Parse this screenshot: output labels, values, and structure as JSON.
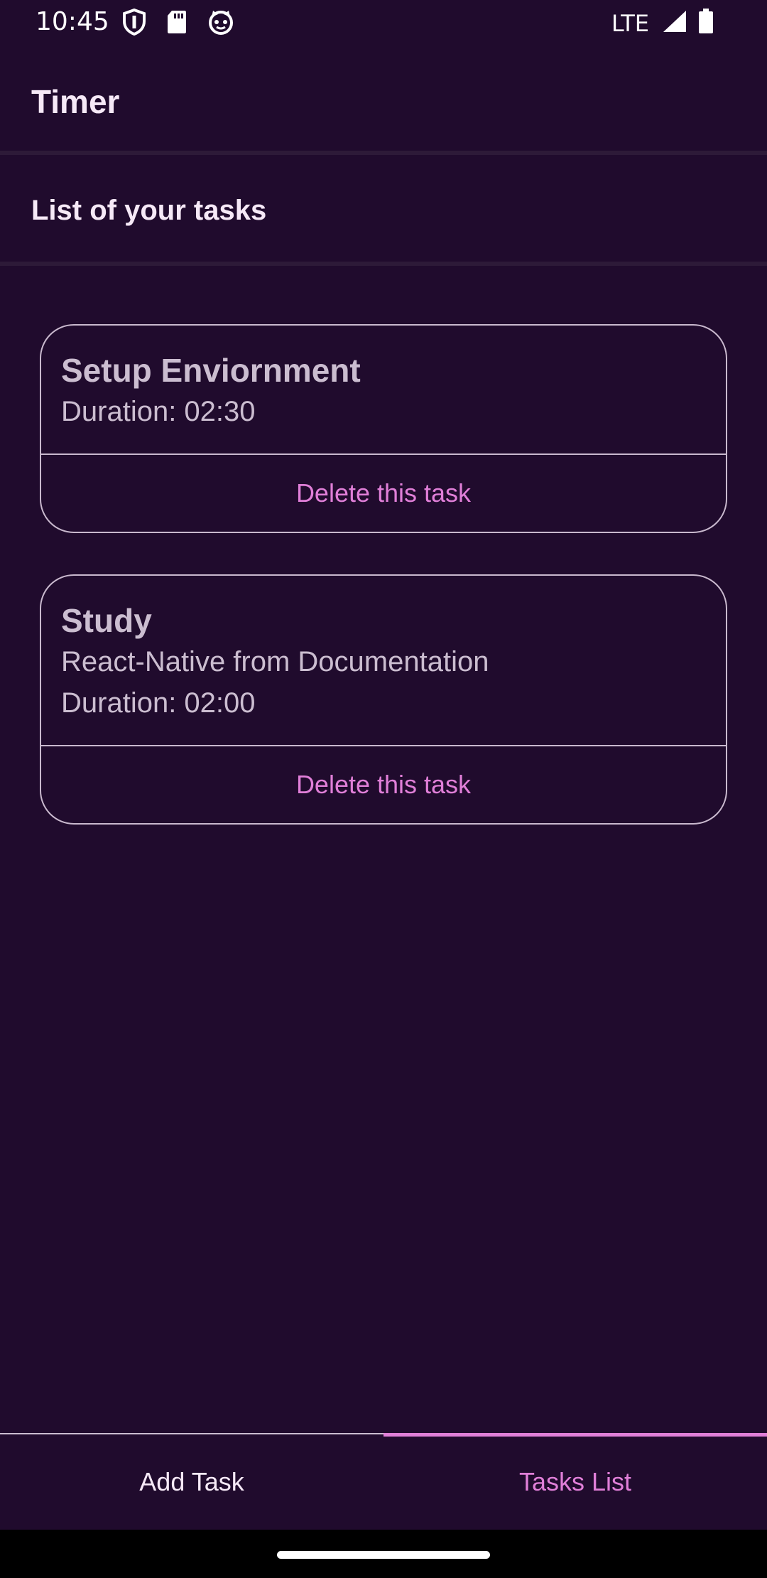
{
  "status_bar": {
    "time": "10:45",
    "network": "LTE",
    "icons": [
      "shield-icon",
      "sd-card-icon",
      "cat-face-icon",
      "signal-icon",
      "battery-icon"
    ]
  },
  "header": {
    "title": "Timer"
  },
  "sub_header": {
    "title": "List of your tasks"
  },
  "tasks": [
    {
      "title": "Setup Enviornment",
      "description": "",
      "duration": "Duration: 02:30",
      "delete_label": "Delete this task"
    },
    {
      "title": "Study",
      "description": "React-Native from Documentation",
      "duration": "Duration: 02:00",
      "delete_label": "Delete this task"
    }
  ],
  "tabs": [
    {
      "label": "Add Task",
      "active": false
    },
    {
      "label": "Tasks List",
      "active": true
    }
  ],
  "colors": {
    "background": "#200b2d",
    "accent": "#e07fd8",
    "card_text": "#cbbdd0"
  }
}
